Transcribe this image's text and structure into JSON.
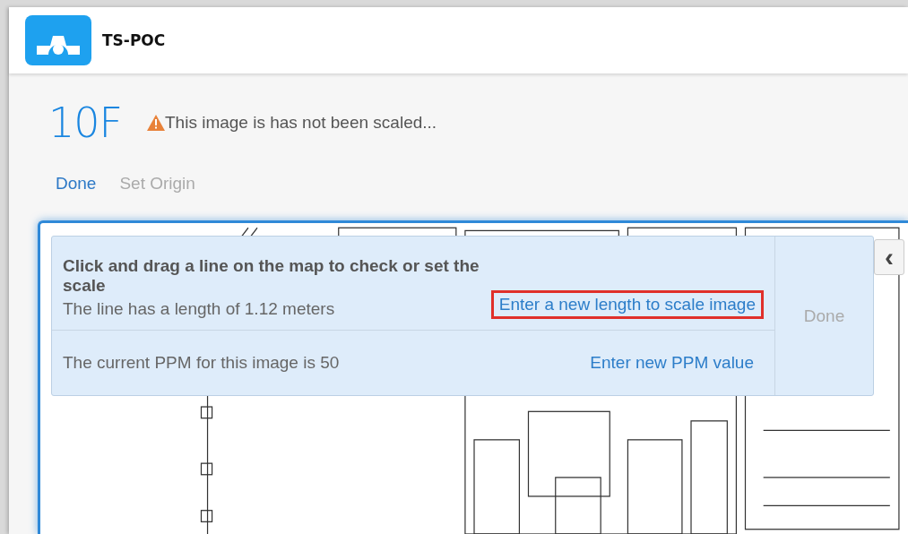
{
  "app": {
    "title": "TS-POC"
  },
  "floor": {
    "name": "10F",
    "warning": "This image is has not been scaled..."
  },
  "toolbar": [
    {
      "label": "Done",
      "disabled": false
    },
    {
      "label": "Set Origin",
      "disabled": true
    }
  ],
  "scale_panel": {
    "heading": "Click and drag a line on the map to check or set the scale",
    "length_text": "The line has a length of 1.12 meters",
    "length_link": {
      "label": "Enter a new length to scale image",
      "highlighted": true
    },
    "ppm_text": "The current PPM for this image is 50",
    "ppm_link": {
      "label": "Enter new PPM value",
      "highlighted": false
    },
    "done": {
      "label": "Done",
      "disabled": true
    }
  },
  "collapse_button": {
    "label": "‹"
  }
}
